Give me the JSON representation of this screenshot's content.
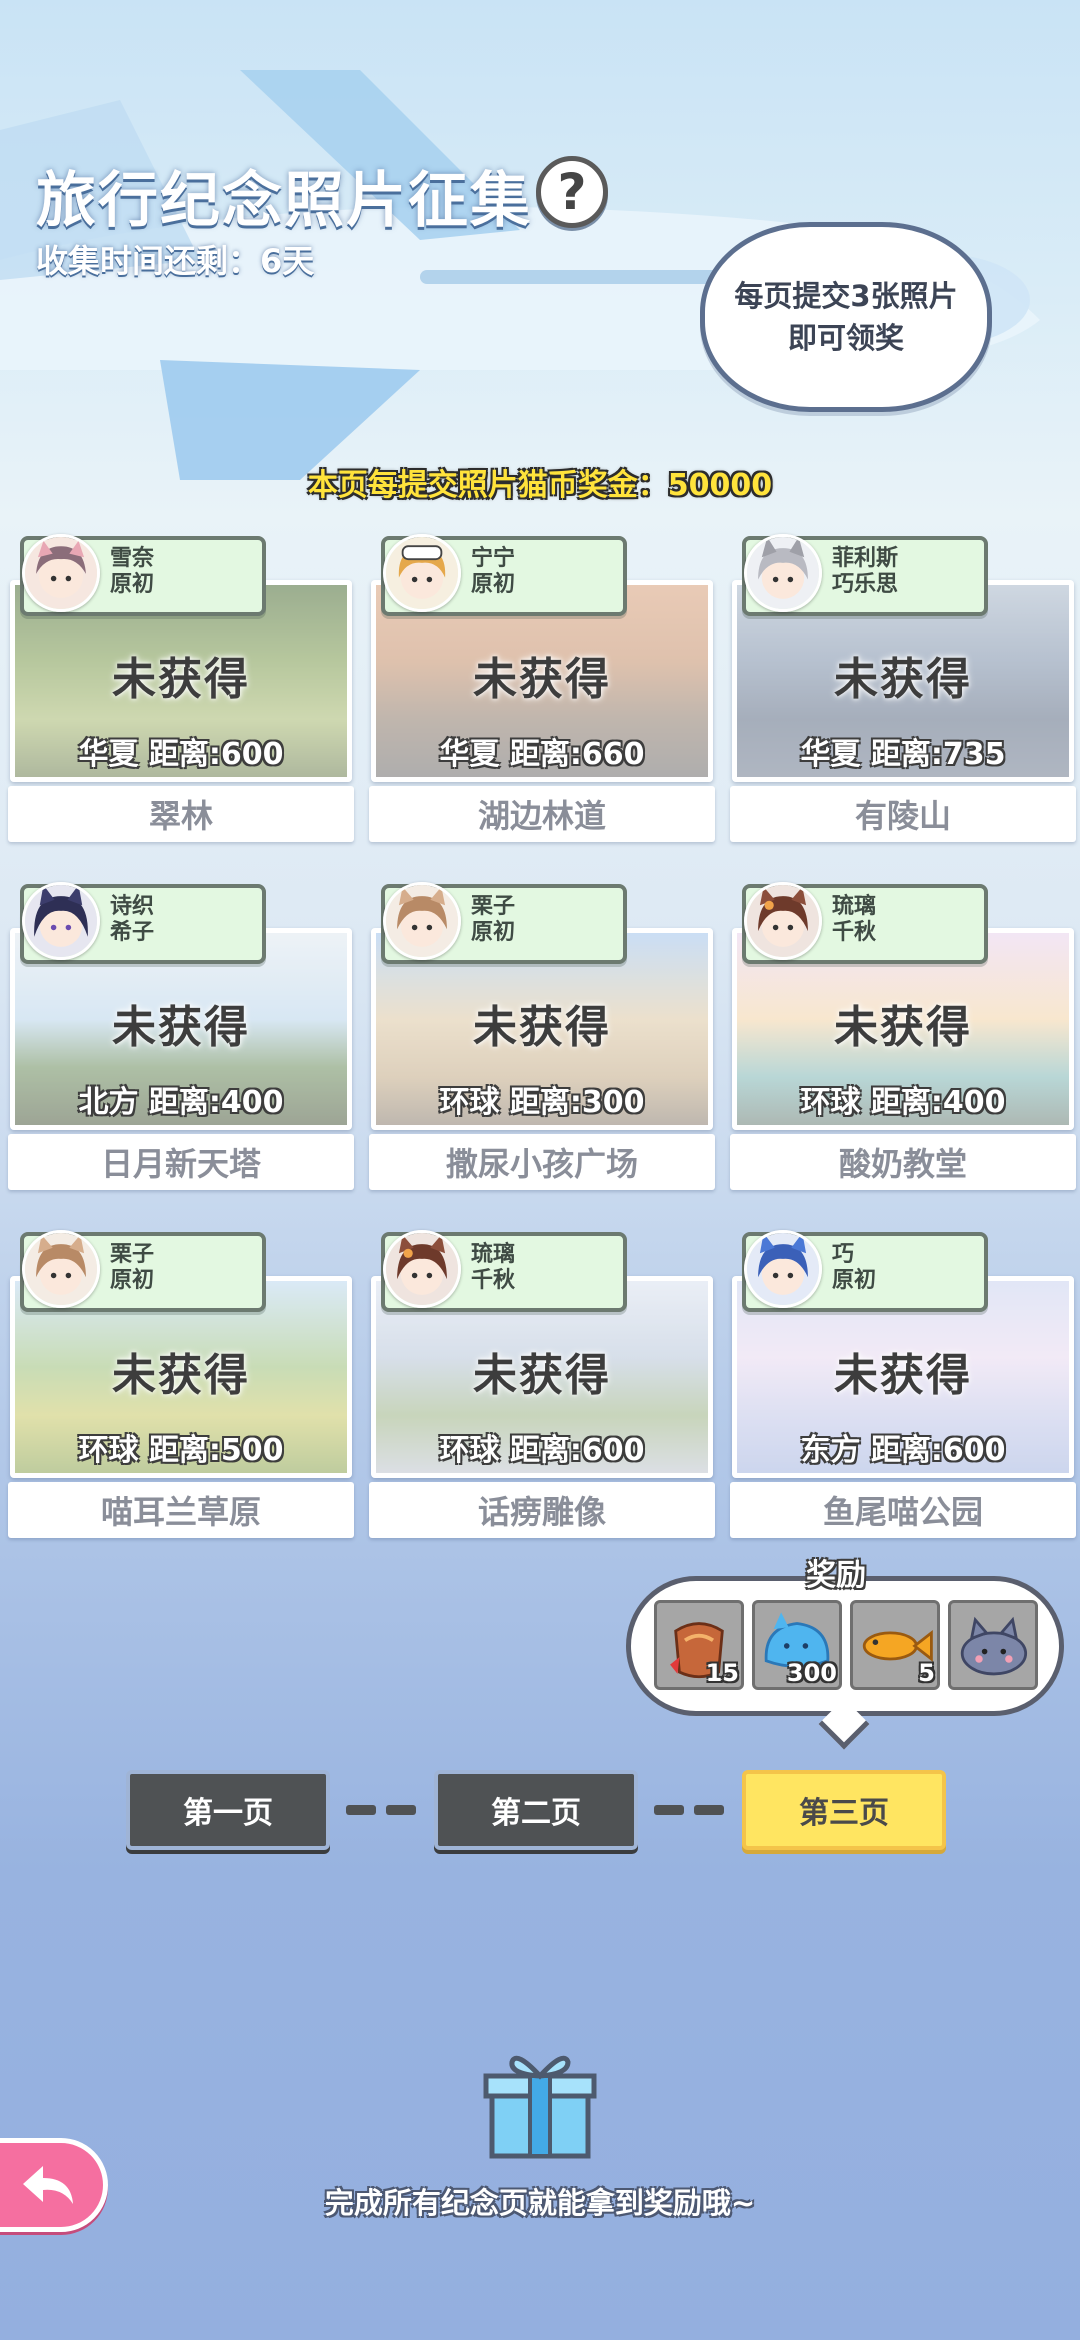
{
  "header": {
    "title": "旅行纪念照片征集",
    "help_icon": "?",
    "countdown": "收集时间还剩：6天"
  },
  "cloud_tip": {
    "line1": "每页提交3张照片",
    "line2": "即可领奖"
  },
  "bonus_line": "本页每提交照片猫币奖金：50000",
  "cards": [
    {
      "names": [
        "雪奈",
        "原初"
      ],
      "status": "未获得",
      "meta": "华夏  距离:600",
      "place": "翠林",
      "avatar_color": "#e8a7b4",
      "hair": "#8b6d7a"
    },
    {
      "names": [
        "宁宁",
        "原初"
      ],
      "status": "未获得",
      "meta": "华夏  距离:660",
      "place": "湖边林道",
      "avatar_color": "#f4c16a",
      "hair": "#e5a84b"
    },
    {
      "names": [
        "菲利斯",
        "巧乐思"
      ],
      "status": "未获得",
      "meta": "华夏  距离:735",
      "place": "有陵山",
      "avatar_color": "#c8c9cf",
      "hair": "#9fa0a8"
    },
    {
      "names": [
        "诗织",
        "希子"
      ],
      "status": "未获得",
      "meta": "北方  距离:400",
      "place": "日月新天塔",
      "avatar_color": "#3c3d6c",
      "hair": "#2e2f55"
    },
    {
      "names": [
        "栗子",
        "原初"
      ],
      "status": "未获得",
      "meta": "环球  距离:300",
      "place": "撒尿小孩广场",
      "avatar_color": "#d6ad8c",
      "hair": "#b88a66"
    },
    {
      "names": [
        "琉璃",
        "千秋"
      ],
      "status": "未获得",
      "meta": "环球  距离:400",
      "place": "酸奶教堂",
      "avatar_color": "#8c4e3b",
      "hair": "#6e3a2b"
    },
    {
      "names": [
        "栗子",
        "原初"
      ],
      "status": "未获得",
      "meta": "环球  距离:500",
      "place": "喵耳兰草原",
      "avatar_color": "#d6ad8c",
      "hair": "#b88a66"
    },
    {
      "names": [
        "琉璃",
        "千秋"
      ],
      "status": "未获得",
      "meta": "环球  距离:600",
      "place": "话痨雕像",
      "avatar_color": "#8c4e3b",
      "hair": "#6e3a2b"
    },
    {
      "names": [
        "巧",
        "原初"
      ],
      "status": "未获得",
      "meta": "东方  距离:600",
      "place": "鱼尾喵公园",
      "avatar_color": "#4b78d6",
      "hair": "#3b60b8"
    }
  ],
  "rewards": {
    "label": "奖励",
    "items": [
      {
        "icon": "fish-bag-icon",
        "qty": "15"
      },
      {
        "icon": "blue-slime-icon",
        "qty": "300"
      },
      {
        "icon": "golden-fish-icon",
        "qty": "5"
      },
      {
        "icon": "cat-plush-icon",
        "qty": ""
      }
    ]
  },
  "pager": {
    "pages": [
      "第一页",
      "第二页",
      "第三页"
    ],
    "active_index": 2
  },
  "footer_hint": "完成所有纪念页就能拿到奖励哦~",
  "colors": {
    "accent_yellow": "#ffe561",
    "back_pink": "#f56fa0",
    "tag_green": "#e3f8e1"
  }
}
